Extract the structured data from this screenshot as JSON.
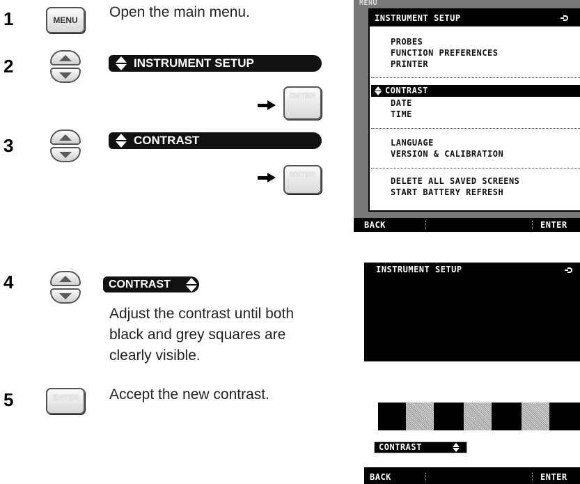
{
  "steps": [
    {
      "num": "1",
      "text": "Open the main menu.",
      "key": "MENU"
    },
    {
      "num": "2",
      "bar": "INSTRUMENT SETUP",
      "confirm_key": "ENTER"
    },
    {
      "num": "3",
      "bar": "CONTRAST",
      "confirm_key": "ENTER"
    },
    {
      "num": "4",
      "bar": "CONTRAST",
      "text_lines": [
        "Adjust the contrast until both",
        "black and grey squares are",
        "clearly visible."
      ]
    },
    {
      "num": "5",
      "key": "ENTER",
      "text": "Accept the new contrast."
    }
  ],
  "screen1": {
    "bg_title": "MENU",
    "title": "INSTRUMENT SETUP",
    "groups": [
      [
        "PROBES",
        "FUNCTION PREFERENCES",
        "PRINTER"
      ],
      [
        "CONTRAST",
        "DATE",
        "TIME"
      ],
      [
        "LANGUAGE",
        "VERSION & CALIBRATION"
      ],
      [
        "DELETE ALL SAVED SCREENS",
        "START BATTERY REFRESH"
      ]
    ],
    "selected": "CONTRAST",
    "softkey_left": "BACK",
    "softkey_right": "ENTER"
  },
  "screen2": {
    "title": "INSTRUMENT SETUP",
    "label": "CONTRAST",
    "softkey_left": "BACK",
    "softkey_right": "ENTER"
  },
  "colors": {
    "lcd_dark": "#000000",
    "lcd_light": "#ffffff",
    "bezel": "#777777"
  }
}
